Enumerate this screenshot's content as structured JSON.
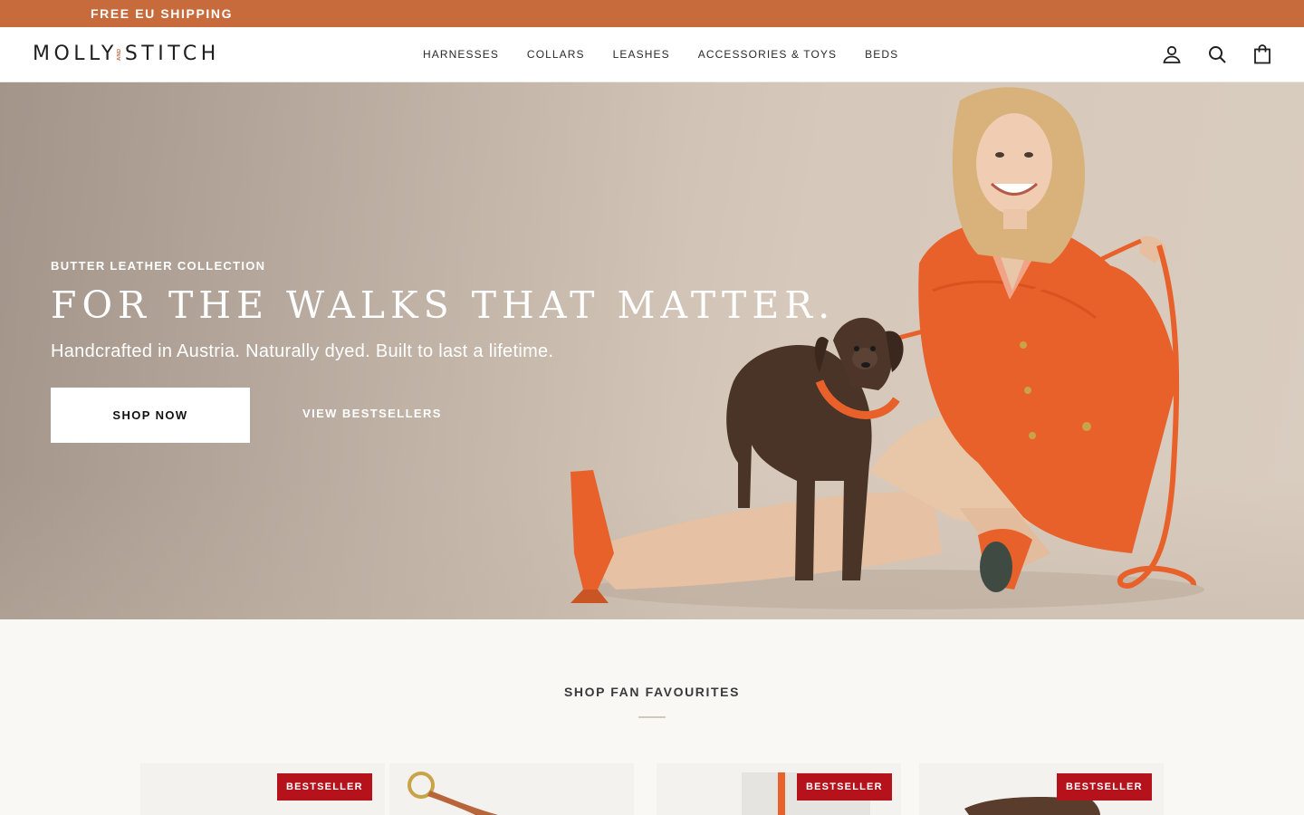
{
  "announcement": {
    "text": "FREE EU SHIPPING"
  },
  "brand": {
    "left": "MOLLY",
    "connector": "AND",
    "right": "STITCH"
  },
  "nav": {
    "items": [
      {
        "label": "HARNESSES"
      },
      {
        "label": "COLLARS"
      },
      {
        "label": "LEASHES"
      },
      {
        "label": "ACCESSORIES & TOYS"
      },
      {
        "label": "BEDS"
      }
    ]
  },
  "header_icons": [
    "account-icon",
    "search-icon",
    "cart-icon"
  ],
  "hero": {
    "eyebrow": "BUTTER LEATHER COLLECTION",
    "title": "FOR THE WALKS THAT MATTER.",
    "subtitle": "Handcrafted in Austria. Naturally dyed. Built to last a lifetime.",
    "primary_cta": "SHOP NOW",
    "secondary_cta": "VIEW BESTSELLERS"
  },
  "products_section": {
    "title": "SHOP FAN FAVOURITES",
    "cards": [
      {
        "badge": "BESTSELLER"
      },
      {
        "badge": "BESTSELLER"
      },
      {
        "badge": "BESTSELLER"
      }
    ]
  },
  "colors": {
    "announcement_bg": "#c86b3c",
    "accent_orange": "#e8612a",
    "badge_red": "#b5121b",
    "section_bg": "#faf8f5"
  }
}
